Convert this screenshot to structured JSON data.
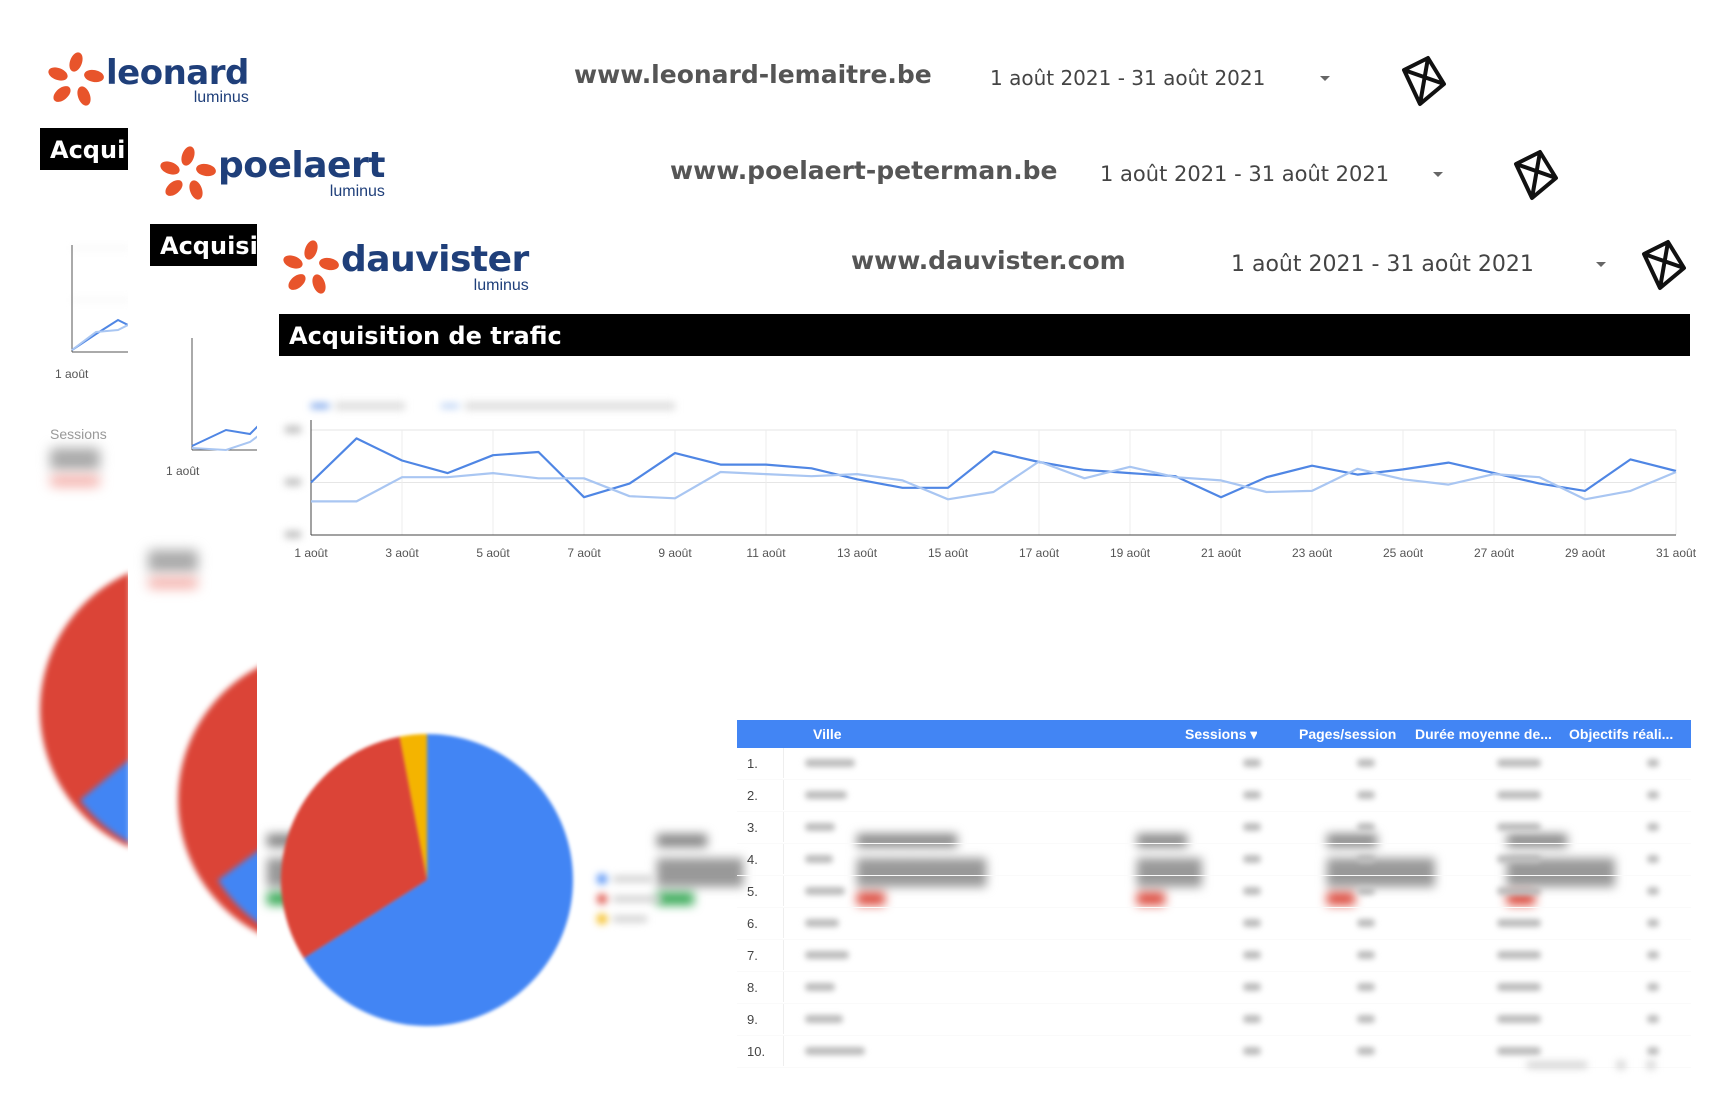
{
  "reports": [
    {
      "brand": "leonard",
      "brand_sub": "luminus",
      "site_url": "www.leonard-lemaitre.be",
      "date_range": "1 août 2021 - 31 août 2021",
      "banner_title": "Acqui",
      "axis_first_label": "1 août",
      "kpi_label": "Sessions"
    },
    {
      "brand": "poelaert",
      "brand_sub": "luminus",
      "site_url": "www.poelaert-peterman.be",
      "date_range": "1 août 2021 - 31 août 2021",
      "banner_title": "Acquisi",
      "axis_first_label": "1 août"
    },
    {
      "brand": "dauvister",
      "brand_sub": "luminus",
      "site_url": "www.dauvister.com",
      "date_range": "1 août 2021 - 31 août 2021",
      "banner_title": "Acquisition de trafic"
    }
  ],
  "table": {
    "columns": [
      "Ville",
      "Sessions ▾",
      "Pages/session",
      "Durée moyenne de...",
      "Objectifs réali..."
    ],
    "row_numbers": [
      "1.",
      "2.",
      "3.",
      "4.",
      "5.",
      "6.",
      "7.",
      "8.",
      "9.",
      "10."
    ]
  },
  "colors": {
    "brand_orange": "#e8542b",
    "brand_navy": "#1f3f7a",
    "series_primary": "#4f86e4",
    "series_secondary": "#a9c6f2",
    "table_header": "#4285f4",
    "pie_blue": "#4285f4",
    "pie_red": "#db4437",
    "pie_yellow": "#f4b400"
  },
  "chart_data": [
    {
      "type": "line",
      "x": [
        "1 août",
        "2 août",
        "3 août",
        "4 août",
        "5 août",
        "6 août",
        "7 août",
        "8 août",
        "9 août",
        "10 août",
        "11 août",
        "12 août",
        "13 août",
        "14 août",
        "15 août",
        "16 août",
        "17 août",
        "18 août",
        "19 août",
        "20 août",
        "21 août",
        "22 août",
        "23 août",
        "24 août",
        "25 août",
        "26 août",
        "27 août",
        "28 août",
        "29 août",
        "30 août",
        "31 août"
      ],
      "x_tick_labels": [
        "1 août",
        "3 août",
        "5 août",
        "7 août",
        "9 août",
        "11 août",
        "13 août",
        "15 août",
        "17 août",
        "19 août",
        "21 août",
        "23 août",
        "25 août",
        "27 août",
        "29 août",
        "31 août"
      ],
      "ylim": [
        0,
        200
      ],
      "grid": true,
      "series": [
        {
          "values": [
            100,
            184,
            142,
            118,
            152,
            158,
            72,
            98,
            156,
            134,
            134,
            127,
            106,
            90,
            90,
            159,
            139,
            124,
            118,
            112,
            72,
            110,
            132,
            115,
            125,
            138,
            118,
            98,
            84,
            144,
            122
          ]
        },
        {
          "values": [
            64,
            64,
            110,
            110,
            118,
            108,
            108,
            74,
            70,
            120,
            116,
            112,
            116,
            104,
            68,
            82,
            140,
            108,
            130,
            110,
            104,
            82,
            84,
            126,
            106,
            96,
            116,
            110,
            68,
            84,
            120
          ]
        }
      ]
    },
    {
      "type": "pie",
      "values": [
        66,
        31,
        3
      ]
    }
  ]
}
